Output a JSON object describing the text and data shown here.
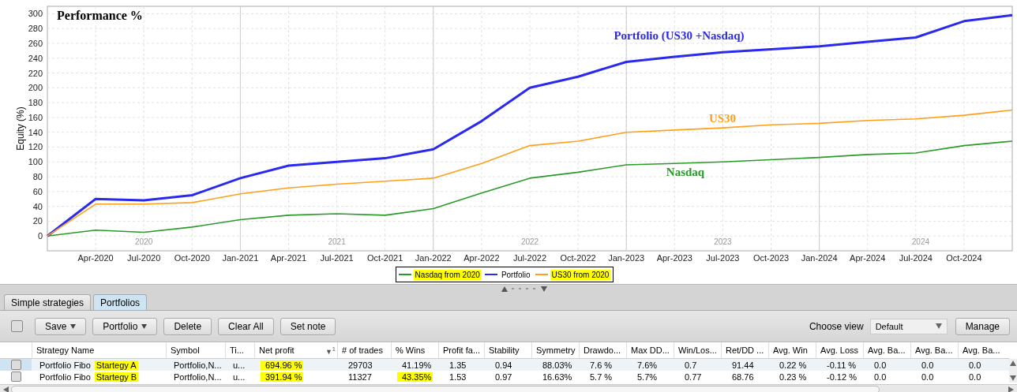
{
  "chart": {
    "chart_data": {
      "type": "line",
      "title": "Performance %",
      "ylabel": "Equity (%)",
      "categories": [
        null,
        "Apr-2020",
        "Jul-2020",
        "Oct-2020",
        "Jan-2021",
        "Apr-2021",
        "Jul-2021",
        "Oct-2021",
        "Jan-2022",
        "Apr-2022",
        "Jul-2022",
        "Oct-2022",
        "Jan-2023",
        "Apr-2023",
        "Jul-2023",
        "Oct-2023",
        "Jan-2024",
        "Apr-2024",
        "Jul-2024",
        "Oct-2024",
        null
      ],
      "ylim": [
        -20,
        310
      ],
      "grid": true,
      "legend": true,
      "yticks": [
        0,
        20,
        40,
        60,
        80,
        100,
        120,
        140,
        160,
        180,
        200,
        220,
        240,
        260,
        280,
        300
      ],
      "series": [
        {
          "name": "Nasdaq from 2020",
          "color": "#2a9a2a",
          "values": [
            0,
            8,
            5,
            12,
            22,
            28,
            30,
            28,
            37,
            58,
            78,
            86,
            96,
            98,
            100,
            103,
            106,
            110,
            112,
            122,
            128
          ]
        },
        {
          "name": "Portfolio",
          "color": "#2a2aee",
          "values": [
            0,
            50,
            48,
            55,
            78,
            95,
            100,
            105,
            117,
            155,
            200,
            215,
            235,
            242,
            248,
            252,
            256,
            262,
            268,
            290,
            298
          ]
        },
        {
          "name": "US30 from 2020",
          "color": "#ff9f1a",
          "values": [
            0,
            43,
            43,
            45,
            57,
            65,
            70,
            74,
            78,
            98,
            122,
            128,
            140,
            143,
            146,
            150,
            152,
            156,
            158,
            163,
            170
          ]
        }
      ],
      "annotations": [
        "Portfolio (US30 +Nasdaq)",
        "US30",
        "Nasdaq",
        "2020",
        "2021",
        "2022",
        "2023",
        "2024"
      ]
    },
    "legend": [
      {
        "highlighted": true
      },
      {
        "highlighted": false
      },
      {
        "highlighted": true
      }
    ]
  },
  "tabs": [
    {
      "label": "Simple strategies",
      "selected": false
    },
    {
      "label": "Portfolios",
      "selected": true
    }
  ],
  "toolbar": {
    "select_all_checked": false,
    "buttons": [
      {
        "label": "Save",
        "dropdown": true
      },
      {
        "label": "Portfolio",
        "dropdown": true
      },
      {
        "label": "Delete",
        "dropdown": false
      },
      {
        "label": "Clear All",
        "dropdown": false
      },
      {
        "label": "Set note",
        "dropdown": false
      }
    ],
    "view_label": "Choose view",
    "view_value": "Default",
    "manage": "Manage"
  },
  "table": {
    "columns": [
      {
        "label": "Strategy Name",
        "sorted": false
      },
      {
        "label": "Symbol",
        "sorted": false
      },
      {
        "label": "Ti...",
        "sorted": false
      },
      {
        "label": "Net profit",
        "sorted": true
      },
      {
        "label": "# of trades",
        "sorted": false
      },
      {
        "label": "% Wins",
        "sorted": false
      },
      {
        "label": "Profit fa...",
        "sorted": false
      },
      {
        "label": "Stability",
        "sorted": false
      },
      {
        "label": "Symmetry",
        "sorted": false
      },
      {
        "label": "Drawdo...",
        "sorted": false
      },
      {
        "label": "Max DD...",
        "sorted": false
      },
      {
        "label": "Win/Los...",
        "sorted": false
      },
      {
        "label": "Ret/DD ...",
        "sorted": false
      },
      {
        "label": "Avg. Win",
        "sorted": false
      },
      {
        "label": "Avg. Loss",
        "sorted": false
      },
      {
        "label": "Avg. Ba...",
        "sorted": false
      },
      {
        "label": "Avg. Ba...",
        "sorted": false
      },
      {
        "label": "Avg. Ba...",
        "sorted": false
      }
    ],
    "sort": {
      "arrow": "▼",
      "order": "1"
    },
    "rows": [
      {
        "selected": true,
        "checked": false,
        "cells": [
          [
            {
              "text": "Portfolio Fibo",
              "highlighted": false
            },
            {
              "text": "Startegy A",
              "highlighted": true
            }
          ],
          [
            {
              "text": "Portfolio,N...",
              "highlighted": false
            }
          ],
          [
            {
              "text": "u...",
              "highlighted": false
            }
          ],
          [
            {
              "text": "694.96 %",
              "highlighted": true
            }
          ],
          [
            {
              "text": "29703",
              "highlighted": false
            }
          ],
          [
            {
              "text": "41.19%",
              "highlighted": false
            }
          ],
          [
            {
              "text": "1.35",
              "highlighted": false
            }
          ],
          [
            {
              "text": "0.94",
              "highlighted": false
            }
          ],
          [
            {
              "text": "88.03%",
              "highlighted": false
            }
          ],
          [
            {
              "text": "7.6 %",
              "highlighted": false
            }
          ],
          [
            {
              "text": "7.6%",
              "highlighted": false
            }
          ],
          [
            {
              "text": "0.7",
              "highlighted": false
            }
          ],
          [
            {
              "text": "91.44",
              "highlighted": false
            }
          ],
          [
            {
              "text": "0.22 %",
              "highlighted": false
            }
          ],
          [
            {
              "text": "-0.11 %",
              "highlighted": false
            }
          ],
          [
            {
              "text": "0.0",
              "highlighted": false
            }
          ],
          [
            {
              "text": "0.0",
              "highlighted": false
            }
          ],
          [
            {
              "text": "0.0",
              "highlighted": false
            }
          ]
        ]
      },
      {
        "selected": false,
        "checked": false,
        "cells": [
          [
            {
              "text": "Portfolio Fibo",
              "highlighted": false
            },
            {
              "text": "Startegy B",
              "highlighted": true
            }
          ],
          [
            {
              "text": "Portfolio,N...",
              "highlighted": false
            }
          ],
          [
            {
              "text": "u...",
              "highlighted": false
            }
          ],
          [
            {
              "text": "391.94 %",
              "highlighted": true
            }
          ],
          [
            {
              "text": "11327",
              "highlighted": false
            }
          ],
          [
            {
              "text": "43.35%",
              "highlighted": true
            }
          ],
          [
            {
              "text": "1.53",
              "highlighted": false
            }
          ],
          [
            {
              "text": "0.97",
              "highlighted": false
            }
          ],
          [
            {
              "text": "16.63%",
              "highlighted": false
            }
          ],
          [
            {
              "text": "5.7 %",
              "highlighted": false
            }
          ],
          [
            {
              "text": "5.7%",
              "highlighted": false
            }
          ],
          [
            {
              "text": "0.77",
              "highlighted": false
            }
          ],
          [
            {
              "text": "68.76",
              "highlighted": false
            }
          ],
          [
            {
              "text": "0.23 %",
              "highlighted": false
            }
          ],
          [
            {
              "text": "-0.12 %",
              "highlighted": false
            }
          ],
          [
            {
              "text": "0.0",
              "highlighted": false
            }
          ],
          [
            {
              "text": "0.0",
              "highlighted": false
            }
          ],
          [
            {
              "text": "0.0",
              "highlighted": false
            }
          ]
        ]
      }
    ]
  }
}
